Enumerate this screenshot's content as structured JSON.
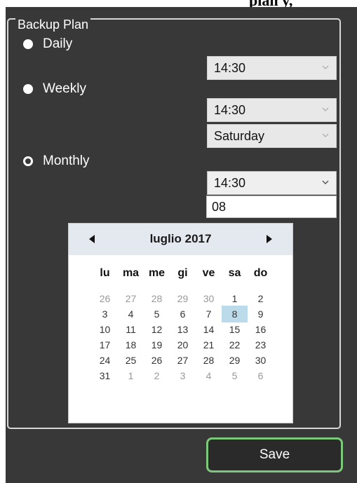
{
  "header_fragment": "plan y,",
  "group_title": "Backup Plan",
  "options": {
    "daily": {
      "label": "Daily",
      "checked": false,
      "time": "14:30"
    },
    "weekly": {
      "label": "Weekly",
      "checked": false,
      "time": "14:30",
      "day": "Saturday"
    },
    "monthly": {
      "label": "Monthly",
      "checked": true,
      "time": "14:30",
      "day_of_month": "08"
    }
  },
  "calendar": {
    "title": "luglio 2017",
    "weekdays": [
      "lu",
      "ma",
      "me",
      "gi",
      "ve",
      "sa",
      "do"
    ],
    "selected": "8",
    "weeks": [
      [
        "26",
        "27",
        "28",
        "29",
        "30",
        "1",
        "2"
      ],
      [
        "3",
        "4",
        "5",
        "6",
        "7",
        "8",
        "9"
      ],
      [
        "10",
        "11",
        "12",
        "13",
        "14",
        "15",
        "16"
      ],
      [
        "17",
        "18",
        "19",
        "20",
        "21",
        "22",
        "23"
      ],
      [
        "24",
        "25",
        "26",
        "27",
        "28",
        "29",
        "30"
      ],
      [
        "31",
        "1",
        "2",
        "3",
        "4",
        "5",
        "6"
      ]
    ]
  },
  "save_label": "Save",
  "icons": {
    "radio": "radio-button-icon",
    "dropdown": "chevron-down-icon",
    "prev": "triangle-left-icon",
    "next": "triangle-right-icon"
  },
  "colors": {
    "panel_bg": "#383838",
    "save_border": "#7cc97c",
    "selected_day": "#bcdbea"
  }
}
